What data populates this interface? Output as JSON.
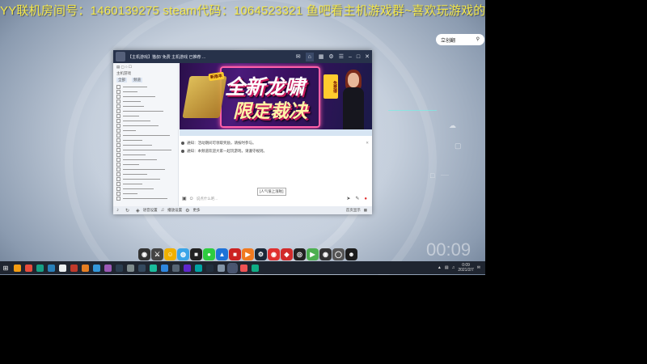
{
  "stream": {
    "banner": "YY联机房间号：1460139275  steam代码：1064523321 鱼吧看主机游戏群~喜欢玩游戏的可以进群哦~"
  },
  "desktop": {
    "search_text": "立创翻",
    "clock": "00:09"
  },
  "app": {
    "title": "【主机游戏】猫叔/ 免费 主机游戏 已推荐 ...",
    "left_panel": {
      "header": "主机游戏",
      "tabs": [
        "全部",
        "频道"
      ]
    },
    "banner": {
      "headline1": "全新龙啸",
      "headline2": "限定裁决",
      "badge": "免费得",
      "tag": "新版本"
    },
    "chat_messages": [
      "通知：活动期间可领取奖励，请按时参与。",
      "通知：本频道欢迎大家一起玩游戏，请遵守规则。"
    ],
    "gift_tip": "[人气值上涨啦]",
    "input_placeholder": "说点什么吧...",
    "bottom": {
      "item1": "语音设置",
      "item2": "播放设置",
      "item3": "更多",
      "right_label": "首页显示"
    }
  },
  "taskbar": {
    "time": "0:09",
    "date": "2021/2/7"
  },
  "colors": {
    "banner_text": "#f4e84a",
    "taskbar_bg": "#1f2530",
    "titlebar_bg": "#27324a",
    "accent_red": "#e23030"
  }
}
